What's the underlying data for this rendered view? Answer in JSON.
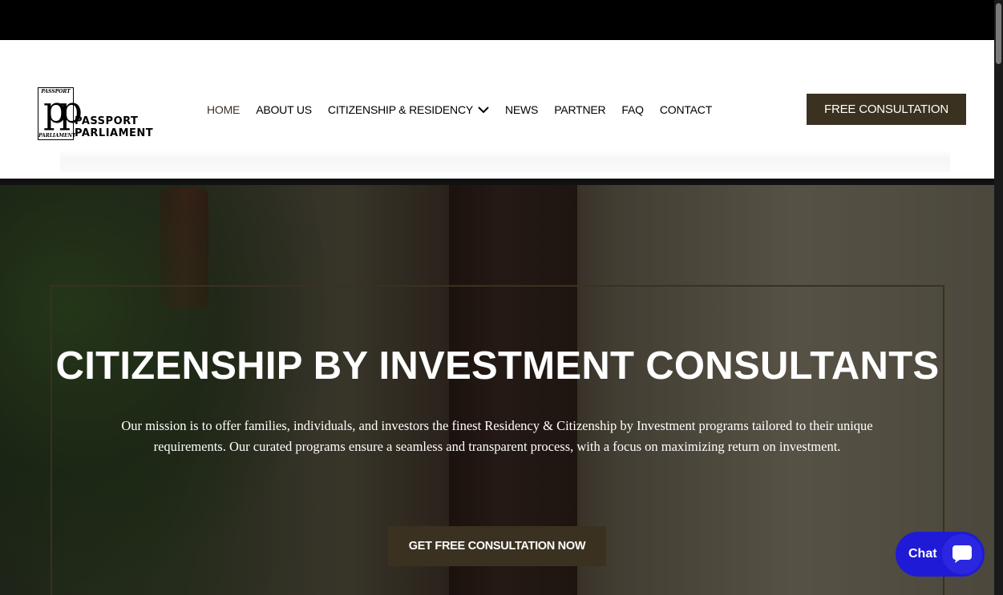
{
  "logo": {
    "small_top": "PASSPORT",
    "small_bottom": "PARLIAMENT",
    "glyph": "pp",
    "word1": "PASSPORT",
    "word2": "PARLIAMENT"
  },
  "nav": {
    "items": [
      {
        "label": "HOME",
        "active": true
      },
      {
        "label": "ABOUT US"
      },
      {
        "label": "CITIZENSHIP & RESIDENCY",
        "has_dropdown": true
      },
      {
        "label": "NEWS"
      },
      {
        "label": "PARTNER"
      },
      {
        "label": "FAQ"
      },
      {
        "label": "CONTACT"
      }
    ]
  },
  "header": {
    "cta_label": "FREE CONSULTATION"
  },
  "hero": {
    "title": "CITIZENSHIP BY INVESTMENT CONSULTANTS",
    "line1": "Our mission is to offer families, individuals, and investors the finest Residency & Citizenship by Investment programs tailored to their unique",
    "line2": "requirements. Our curated programs ensure a seamless and transparent process, with a focus on maximizing return on investment.",
    "cta_label": "GET FREE CONSULTATION NOW"
  },
  "chat": {
    "label": "Chat",
    "icon": "chat-bubble-icon"
  },
  "colors": {
    "brand": "#3a3120",
    "chat": "#1f1ad6"
  }
}
